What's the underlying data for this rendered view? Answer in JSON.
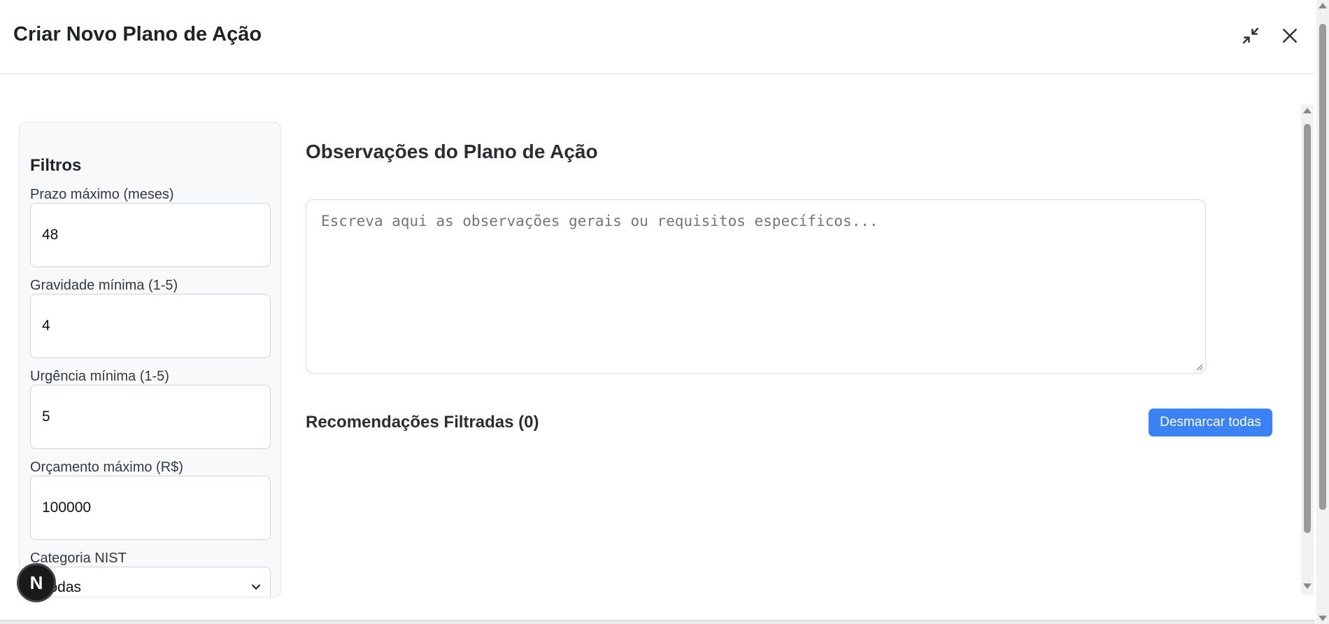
{
  "header": {
    "title": "Criar Novo Plano de Ação",
    "minimize_icon": "collapse-arrows-icon",
    "close_icon": "close-icon"
  },
  "filters": {
    "title": "Filtros",
    "fields": [
      {
        "label": "Prazo máximo (meses)",
        "value": "48"
      },
      {
        "label": "Gravidade mínima (1-5)",
        "value": "4"
      },
      {
        "label": "Urgência mínima (1-5)",
        "value": "5"
      },
      {
        "label": "Orçamento máximo (R$)",
        "value": "100000"
      }
    ],
    "category": {
      "label": "Categoria NIST",
      "value": "Todas"
    }
  },
  "notes": {
    "title": "Observações do Plano de Ação",
    "placeholder": "Escreva aqui as observações gerais ou requisitos específicos..."
  },
  "recommendations": {
    "title": "Recomendações Filtradas (0)",
    "deselect_label": "Desmarcar todas"
  },
  "fab": {
    "letter": "N"
  },
  "colors": {
    "primary": "#3b82f6",
    "panel": "#f8f9fa"
  }
}
